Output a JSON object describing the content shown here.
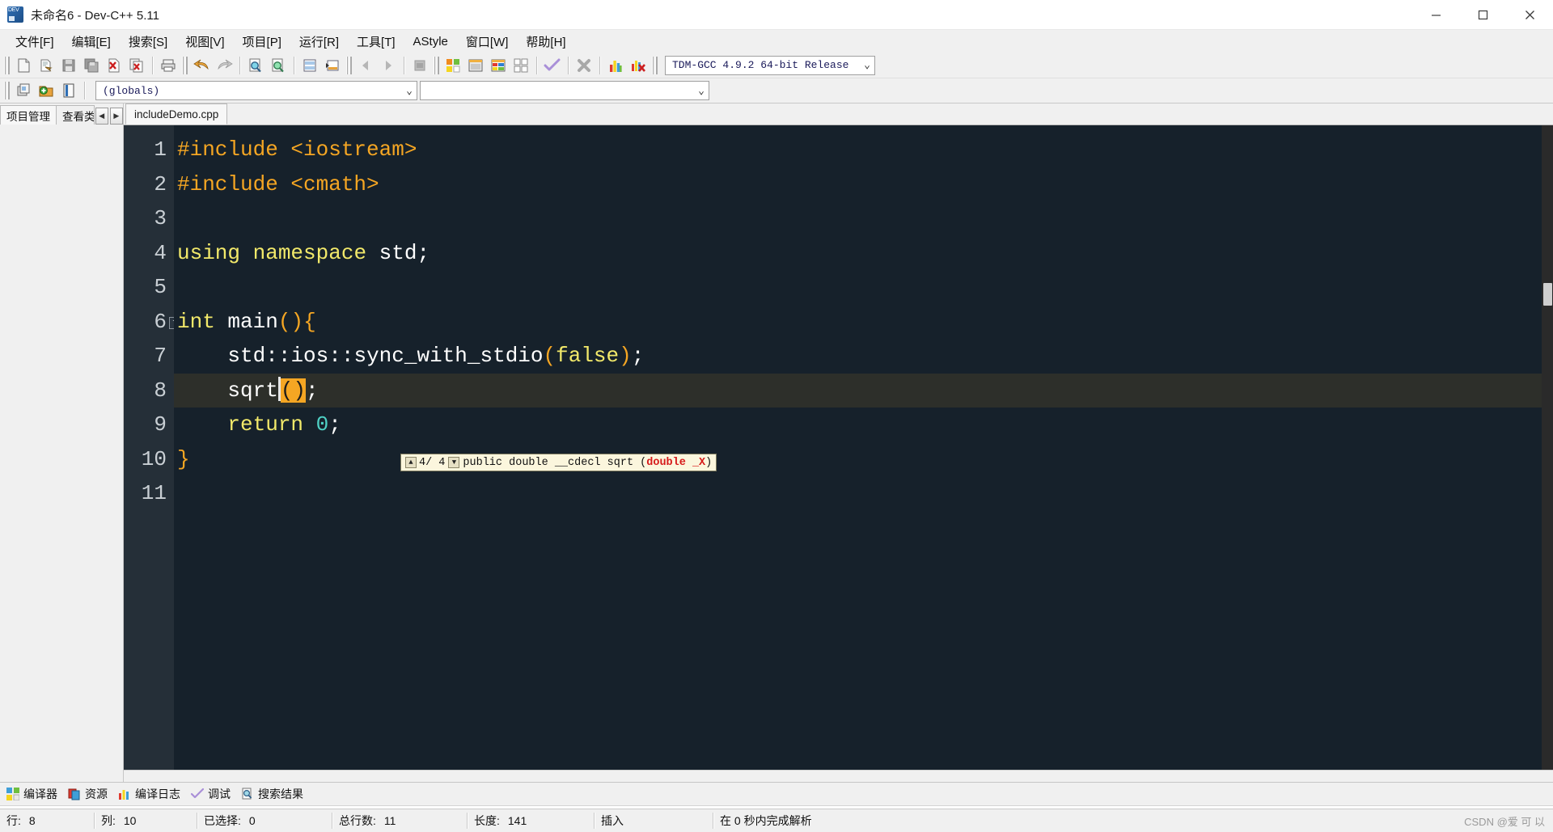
{
  "window": {
    "title": "未命名6 - Dev-C++ 5.11",
    "app_icon": "dev-cpp-icon",
    "minimize": "─",
    "maximize": "☐",
    "close": "✕"
  },
  "menu": [
    {
      "label": "文件[F]",
      "name": "menu-file"
    },
    {
      "label": "编辑[E]",
      "name": "menu-edit"
    },
    {
      "label": "搜索[S]",
      "name": "menu-search"
    },
    {
      "label": "视图[V]",
      "name": "menu-view"
    },
    {
      "label": "项目[P]",
      "name": "menu-project"
    },
    {
      "label": "运行[R]",
      "name": "menu-run"
    },
    {
      "label": "工具[T]",
      "name": "menu-tools"
    },
    {
      "label": "AStyle",
      "name": "menu-astyle"
    },
    {
      "label": "窗口[W]",
      "name": "menu-window"
    },
    {
      "label": "帮助[H]",
      "name": "menu-help"
    }
  ],
  "toolbar": {
    "compiler_combo": {
      "value": "TDM-GCC 4.9.2 64-bit Release",
      "arrow": "⌄"
    },
    "buttons": [
      {
        "name": "new-file-button",
        "icon": "new-file-icon"
      },
      {
        "name": "open-file-button",
        "icon": "open-folder-icon"
      },
      {
        "name": "save-file-button",
        "icon": "save-icon"
      },
      {
        "name": "save-all-button",
        "icon": "save-all-icon"
      },
      {
        "name": "close-file-button",
        "icon": "close-file-icon"
      },
      {
        "name": "close-all-button",
        "icon": "close-all-icon"
      },
      {
        "name": "print-button",
        "icon": "printer-icon"
      },
      {
        "name": "undo-button",
        "icon": "undo-arrow-icon"
      },
      {
        "name": "redo-button",
        "icon": "redo-arrow-icon"
      },
      {
        "name": "find-button",
        "icon": "magnifier-icon"
      },
      {
        "name": "replace-button",
        "icon": "magnifier-replace-icon"
      },
      {
        "name": "goto-line-button",
        "icon": "goto-line-icon"
      },
      {
        "name": "goto-function-button",
        "icon": "goto-function-icon"
      },
      {
        "name": "back-button",
        "icon": "nav-back-icon"
      },
      {
        "name": "forward-button",
        "icon": "nav-forward-icon"
      },
      {
        "name": "toggle-bookmark-button",
        "icon": "bookmark-icon"
      },
      {
        "name": "compile-button",
        "icon": "compile-grid-icon"
      },
      {
        "name": "run-button",
        "icon": "run-window-icon"
      },
      {
        "name": "compile-run-button",
        "icon": "compile-run-icon"
      },
      {
        "name": "rebuild-all-button",
        "icon": "rebuild-grid-icon"
      },
      {
        "name": "syntax-check-button",
        "icon": "check-mark-icon"
      },
      {
        "name": "stop-execution-button",
        "icon": "stop-icon"
      },
      {
        "name": "profile-button",
        "icon": "bar-chart-icon"
      },
      {
        "name": "delete-profile-button",
        "icon": "bar-chart-delete-icon"
      }
    ]
  },
  "toolbar2": {
    "buttons": [
      {
        "name": "project-view-button",
        "icon": "window-stack-icon"
      },
      {
        "name": "add-to-project-button",
        "icon": "add-folder-icon"
      },
      {
        "name": "class-browser-button",
        "icon": "book-icon"
      }
    ],
    "globals_combo": {
      "value": "(globals)",
      "arrow": "⌄"
    },
    "members_combo": {
      "value": "",
      "arrow": "⌄"
    }
  },
  "left_panel": {
    "tabs": [
      {
        "label": "项目管理",
        "name": "tab-project-manager",
        "selected": true
      },
      {
        "label": "查看类",
        "name": "tab-class-browser",
        "selected": false
      }
    ],
    "nav_prev": "◀",
    "nav_next": "▶"
  },
  "editor": {
    "file_tabs": [
      {
        "label": "includeDemo.cpp",
        "name": "file-tab-includedemo",
        "selected": true
      }
    ],
    "line_numbers": [
      "1",
      "2",
      "3",
      "4",
      "5",
      "6",
      "7",
      "8",
      "9",
      "10",
      "11"
    ],
    "fold_marker": "−",
    "lines": [
      {
        "n": 1,
        "tokens": [
          {
            "t": "#include <iostream>",
            "c": "k-pre"
          }
        ]
      },
      {
        "n": 2,
        "tokens": [
          {
            "t": "#include <cmath>",
            "c": "k-pre"
          }
        ]
      },
      {
        "n": 3,
        "tokens": [
          {
            "t": "",
            "c": "k-id"
          }
        ]
      },
      {
        "n": 4,
        "tokens": [
          {
            "t": "using",
            "c": "k-kw"
          },
          {
            "t": " ",
            "c": "k-id"
          },
          {
            "t": "namespace",
            "c": "k-kw"
          },
          {
            "t": " ",
            "c": "k-id"
          },
          {
            "t": "std",
            "c": "k-id"
          },
          {
            "t": ";",
            "c": "k-punct"
          }
        ]
      },
      {
        "n": 5,
        "tokens": [
          {
            "t": "",
            "c": "k-id"
          }
        ]
      },
      {
        "n": 6,
        "tokens": [
          {
            "t": "int",
            "c": "k-kw"
          },
          {
            "t": " ",
            "c": "k-id"
          },
          {
            "t": "main",
            "c": "k-id"
          },
          {
            "t": "()",
            "c": "k-paren"
          },
          {
            "t": "{",
            "c": "k-brace"
          }
        ]
      },
      {
        "n": 7,
        "tokens": [
          {
            "t": "    std",
            "c": "k-id"
          },
          {
            "t": "::",
            "c": "k-punct"
          },
          {
            "t": "ios",
            "c": "k-id"
          },
          {
            "t": "::",
            "c": "k-punct"
          },
          {
            "t": "sync_with_stdio",
            "c": "k-id"
          },
          {
            "t": "(",
            "c": "k-paren"
          },
          {
            "t": "false",
            "c": "k-kw"
          },
          {
            "t": ")",
            "c": "k-paren"
          },
          {
            "t": ";",
            "c": "k-punct"
          }
        ]
      },
      {
        "n": 8,
        "tokens": [
          {
            "t": "    sqrt",
            "c": "k-id"
          },
          {
            "t": "()",
            "c": "sel-paren"
          },
          {
            "t": ";",
            "c": "k-punct"
          }
        ]
      },
      {
        "n": 9,
        "tokens": [
          {
            "t": "    return",
            "c": "k-kw"
          },
          {
            "t": " ",
            "c": "k-id"
          },
          {
            "t": "0",
            "c": "k-num"
          },
          {
            "t": ";",
            "c": "k-punct"
          }
        ]
      },
      {
        "n": 10,
        "tokens": [
          {
            "t": "}",
            "c": "k-brace"
          }
        ]
      },
      {
        "n": 11,
        "tokens": [
          {
            "t": "",
            "c": "k-id"
          }
        ]
      }
    ],
    "active_line": 8,
    "hint": {
      "up_arrow": "▲",
      "down_arrow": "▼",
      "counter": "4/ 4",
      "signature_prefix": "public double __cdecl sqrt (",
      "signature_param": "double _X",
      "signature_suffix": ")"
    }
  },
  "bottom_tabs": [
    {
      "label": "编译器",
      "name": "bottom-tab-compiler",
      "icon": "compiler-grid-icon"
    },
    {
      "label": "资源",
      "name": "bottom-tab-resources",
      "icon": "resource-icon"
    },
    {
      "label": "编译日志",
      "name": "bottom-tab-compile-log",
      "icon": "log-chart-icon"
    },
    {
      "label": "调试",
      "name": "bottom-tab-debug",
      "icon": "check-mark-icon"
    },
    {
      "label": "搜索结果",
      "name": "bottom-tab-search-results",
      "icon": "search-result-icon"
    }
  ],
  "status_bar": {
    "row_label": "行:",
    "row_value": "8",
    "col_label": "列:",
    "col_value": "10",
    "selected_label": "已选择:",
    "selected_value": "0",
    "total_lines_label": "总行数:",
    "total_lines_value": "11",
    "length_label": "长度:",
    "length_value": "141",
    "mode": "插入",
    "parse_message": "在 0 秒内完成解析"
  },
  "watermark": "CSDN @爱 可 以"
}
